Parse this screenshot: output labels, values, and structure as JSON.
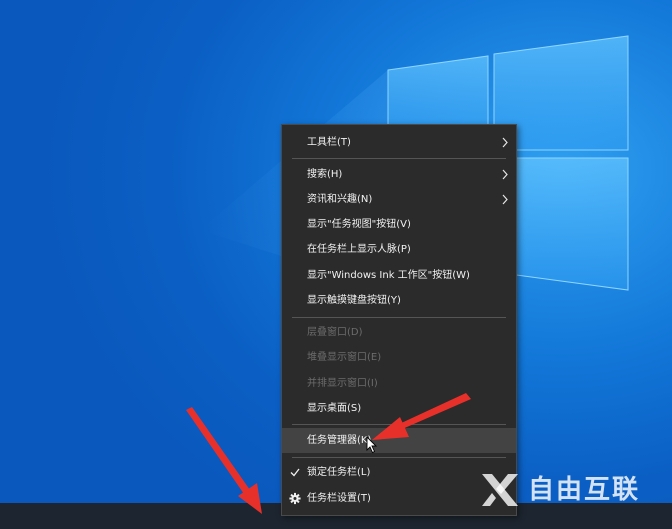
{
  "context_menu": {
    "items": [
      {
        "label": "工具栏(T)",
        "submenu": true,
        "enabled": true
      },
      {
        "label": "搜索(H)",
        "submenu": true,
        "enabled": true
      },
      {
        "label": "资讯和兴趣(N)",
        "submenu": true,
        "enabled": true
      },
      {
        "label": "显示\"任务视图\"按钮(V)",
        "enabled": true
      },
      {
        "label": "在任务栏上显示人脉(P)",
        "enabled": true
      },
      {
        "label": "显示\"Windows Ink 工作区\"按钮(W)",
        "enabled": true
      },
      {
        "label": "显示触摸键盘按钮(Y)",
        "enabled": true
      },
      {
        "label": "层叠窗口(D)",
        "enabled": false
      },
      {
        "label": "堆叠显示窗口(E)",
        "enabled": false
      },
      {
        "label": "并排显示窗口(I)",
        "enabled": false
      },
      {
        "label": "显示桌面(S)",
        "enabled": true
      },
      {
        "label": "任务管理器(K)",
        "enabled": true,
        "highlighted": true
      },
      {
        "label": "锁定任务栏(L)",
        "enabled": true,
        "checked": true
      },
      {
        "label": "任务栏设置(T)",
        "enabled": true,
        "icon": "gear-icon"
      }
    ]
  },
  "watermark": {
    "text": "自由互联",
    "icon": "x-logo-icon"
  },
  "colors": {
    "menu_bg": "#2b2b2b",
    "menu_highlight": "#434343",
    "arrow_red": "#e8302a",
    "desktop_blue": "#1277d8"
  }
}
